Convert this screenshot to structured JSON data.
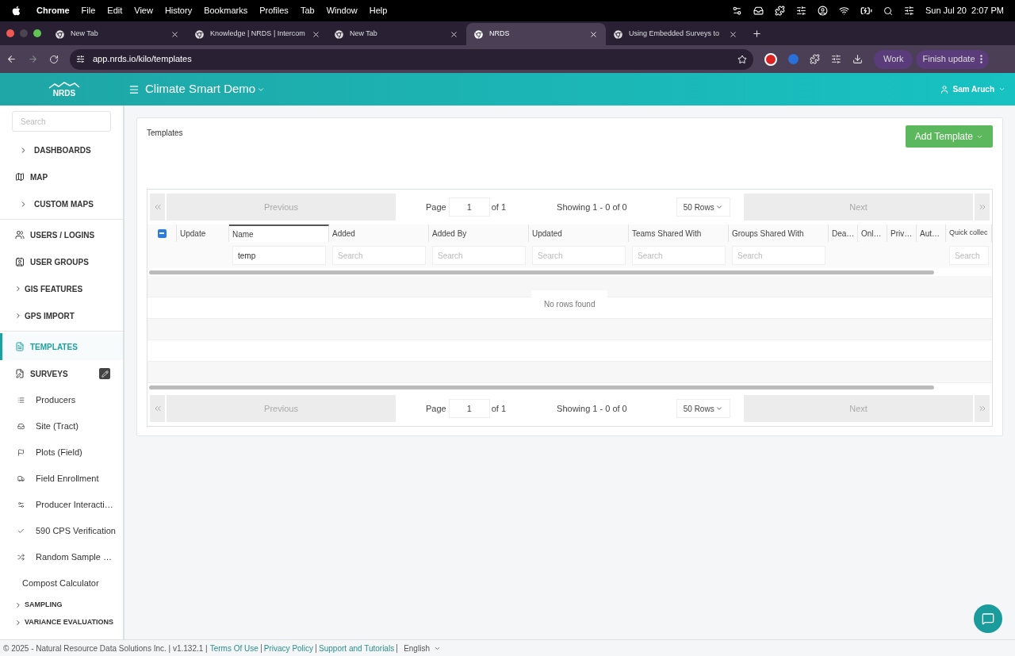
{
  "menubar": {
    "app": "Chrome",
    "items": [
      "File",
      "Edit",
      "View",
      "History",
      "Bookmarks",
      "Profiles",
      "Tab",
      "Window",
      "Help"
    ],
    "clock": "Sun Jul 20  2:07 PM"
  },
  "browser_tabs": [
    {
      "title": "New Tab",
      "selected": false
    },
    {
      "title": "Knowledge | NRDS | Intercom",
      "selected": false
    },
    {
      "title": "New Tab",
      "selected": false
    },
    {
      "title": "NRDS",
      "selected": true
    },
    {
      "title": "Using Embedded Surveys to",
      "selected": false
    }
  ],
  "address_bar": {
    "url": "app.nrds.io/kilo/templates",
    "profile": "Work",
    "update_button": "Finish update"
  },
  "header": {
    "logo": "NRDS",
    "project": "Climate Smart Demo",
    "user": "Sam Aruch"
  },
  "sidebar": {
    "search_placeholder": "Search",
    "items": [
      {
        "kind": "group",
        "label": "DASHBOARDS",
        "selected": false
      },
      {
        "kind": "link",
        "label": "MAP",
        "selected": false
      },
      {
        "kind": "group",
        "label": "CUSTOM MAPS",
        "selected": false
      },
      {
        "kind": "divider"
      },
      {
        "kind": "link",
        "label": "USERS / LOGINS",
        "selected": false
      },
      {
        "kind": "link",
        "label": "USER GROUPS",
        "selected": false
      },
      {
        "kind": "subgroup",
        "label": "GIS FEATURES",
        "selected": false
      },
      {
        "kind": "subgroup",
        "label": "GPS IMPORT",
        "selected": false
      },
      {
        "kind": "divider"
      },
      {
        "kind": "link",
        "label": "TEMPLATES",
        "selected": true
      },
      {
        "kind": "link",
        "label": "SURVEYS",
        "selected": false,
        "edit": true
      },
      {
        "kind": "sub",
        "label": "Producers",
        "selected": false
      },
      {
        "kind": "sub",
        "label": "Site (Tract)",
        "selected": false
      },
      {
        "kind": "sub",
        "label": "Plots (Field)",
        "selected": false
      },
      {
        "kind": "sub",
        "label": "Field Enrollment",
        "selected": false
      },
      {
        "kind": "sub",
        "label": "Producer Interacti…",
        "selected": false
      },
      {
        "kind": "sub",
        "label": "590 CPS Verification",
        "selected": false
      },
      {
        "kind": "sub",
        "label": "Random Sample …",
        "selected": false
      },
      {
        "kind": "plain",
        "label": "Compost Calculator",
        "selected": false
      },
      {
        "kind": "small",
        "label": "SAMPLING",
        "selected": false
      },
      {
        "kind": "small",
        "label": "VARIANCE EVALUATIONS",
        "selected": false
      }
    ]
  },
  "card": {
    "title": "Templates",
    "add_button": "Add Template"
  },
  "pagination_top": {
    "previous": "Previous",
    "page_label": "Page",
    "page": "1",
    "of": "of 1",
    "showing": "Showing 1 - 0 of 0",
    "rows": "50 Rows",
    "next": "Next"
  },
  "table": {
    "select_all_indeterminate": true,
    "columns": [
      {
        "label": "Update",
        "sorted": false
      },
      {
        "label": "Name",
        "sorted": true,
        "filter": {
          "value": "temp"
        }
      },
      {
        "label": "Added",
        "sorted": false,
        "filter": {
          "placeholder": "Search"
        }
      },
      {
        "label": "Added By",
        "sorted": false,
        "filter": {
          "placeholder": "Search"
        }
      },
      {
        "label": "Updated",
        "sorted": false,
        "filter": {
          "placeholder": "Search"
        }
      },
      {
        "label": "Teams Shared With",
        "sorted": false,
        "filter": {
          "placeholder": "Search"
        }
      },
      {
        "label": "Groups Shared With",
        "sorted": false,
        "filter": {
          "placeholder": "Search"
        }
      },
      {
        "label": "Dea…",
        "sorted": false
      },
      {
        "label": "Onl…",
        "sorted": false
      },
      {
        "label": "Priv…",
        "sorted": false
      },
      {
        "label": "Aut…",
        "sorted": false
      },
      {
        "label": "Quick collec",
        "sorted": false,
        "filter": {
          "placeholder": "Search"
        }
      }
    ],
    "empty_message": "No rows found"
  },
  "pagination_bottom": {
    "previous": "Previous",
    "page_label": "Page",
    "page": "1",
    "of": "of 1",
    "showing": "Showing 1 - 0 of 0",
    "rows": "50 Rows",
    "next": "Next"
  },
  "footer": {
    "copyright": "© 2025 - Natural Resource Data Solutions Inc. | v1.132.1 |",
    "links": [
      "Terms Of Use",
      "Privacy Policy",
      "Support and Tutorials"
    ],
    "language": "English"
  }
}
